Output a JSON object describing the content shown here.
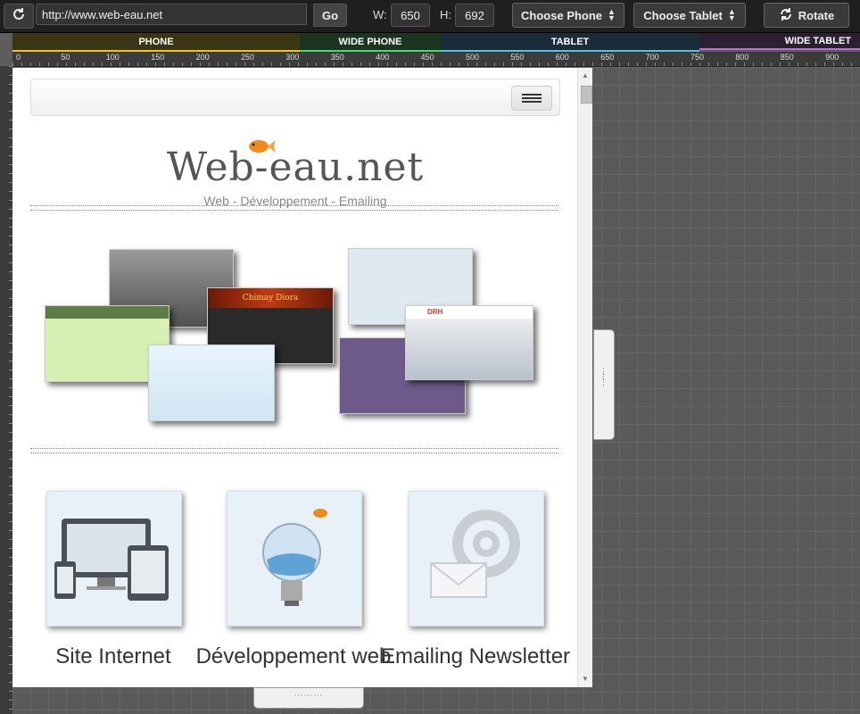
{
  "toolbar": {
    "url": "http://www.web-eau.net",
    "go_label": "Go",
    "width_label": "W:",
    "width_value": "650",
    "height_label": "H:",
    "height_value": "692",
    "choose_phone_label": "Choose Phone",
    "choose_tablet_label": "Choose Tablet",
    "rotate_label": "Rotate",
    "icons": [
      "refresh-icon",
      "sort-icon",
      "rotate-icon"
    ]
  },
  "breakpoints": [
    {
      "label": "PHONE",
      "color": "#3b3513"
    },
    {
      "label": "WIDE PHONE",
      "color": "#19351f"
    },
    {
      "label": "TABLET",
      "color": "#1a2c3a"
    },
    {
      "label": "WIDE TABLET",
      "color": "#2c1f33"
    }
  ],
  "ruler": {
    "ticks": [
      "0",
      "50",
      "100",
      "150",
      "200",
      "250",
      "300",
      "350",
      "400",
      "450",
      "500",
      "550",
      "600",
      "650",
      "700",
      "750",
      "800",
      "850",
      "900"
    ]
  },
  "site": {
    "logo_text": "Web-eau.net",
    "tagline": "Web - Développement - Emailing",
    "services": [
      {
        "label": "Site Internet",
        "icon": "devices-icon"
      },
      {
        "label": "Développement web",
        "icon": "lightbulb-icon"
      },
      {
        "label": "Emailing Newsletter",
        "icon": "email-icon"
      }
    ],
    "portfolio_thumb_text": [
      "Chimay Diora",
      "DRH"
    ]
  },
  "colors": {
    "accent_phone": "#f0c419",
    "accent_wide_phone": "#4cd964",
    "accent_tablet": "#5bc0de",
    "accent_wide_tablet": "#c06bd6"
  }
}
